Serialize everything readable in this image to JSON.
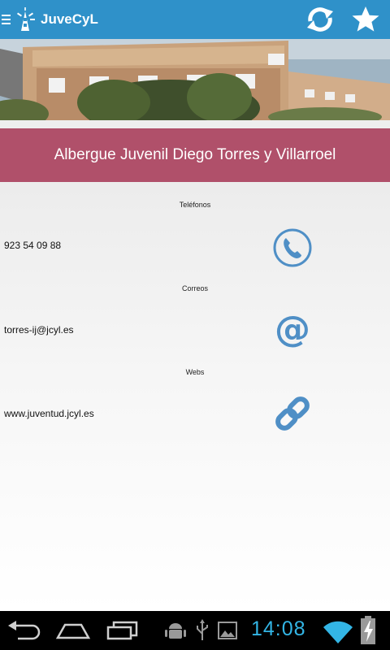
{
  "app": {
    "title": "JuveCyL"
  },
  "header": {
    "icons": [
      "menu-icon",
      "logo-icon",
      "refresh-icon",
      "star-icon"
    ]
  },
  "hero": {
    "image": "building-photo"
  },
  "banner": {
    "title": "Albergue Juvenil Diego Torres y Villarroel"
  },
  "sections": [
    {
      "title": "Teléfonos",
      "value": "923 54 09 88",
      "icon": "phone-icon"
    },
    {
      "title": "Correos",
      "value": "torres-ij@jcyl.es",
      "icon": "email-at-icon"
    },
    {
      "title": "Webs",
      "value": "www.juventud.jcyl.es",
      "icon": "link-icon"
    }
  ],
  "status_bar": {
    "time": "14:08"
  },
  "colors": {
    "app_bar": "#2f91c9",
    "banner": "#b0506a",
    "icon_blue": "#4f8fc6",
    "clock": "#33b5e5"
  }
}
